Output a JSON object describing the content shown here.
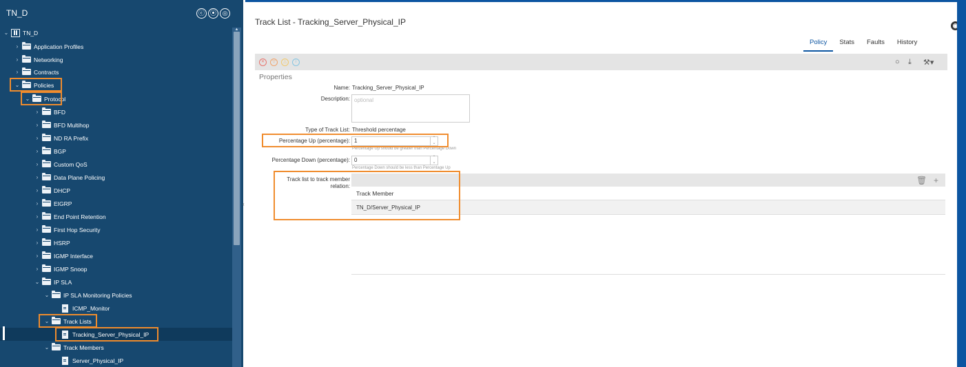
{
  "left_pane": {
    "title": "TN_D",
    "header_icons": [
      "ⓒ",
      "⦿",
      "◎"
    ],
    "tree": [
      {
        "label": "TN_D",
        "icon": "tenant-icon",
        "expanded": true
      },
      {
        "label": "Application Profiles",
        "icon": "folder-icon",
        "expanded": false
      },
      {
        "label": "Networking",
        "icon": "folder-icon",
        "expanded": false
      },
      {
        "label": "Contracts",
        "icon": "folder-icon",
        "expanded": false
      },
      {
        "label": "Policies",
        "icon": "folder-icon",
        "expanded": true
      },
      {
        "label": "Protocol",
        "icon": "folder-icon",
        "expanded": true
      },
      {
        "label": "BFD",
        "icon": "folder-icon",
        "expanded": false
      },
      {
        "label": "BFD Multihop",
        "icon": "folder-icon",
        "expanded": false
      },
      {
        "label": "ND RA Prefix",
        "icon": "folder-icon",
        "expanded": false
      },
      {
        "label": "BGP",
        "icon": "folder-icon",
        "expanded": false
      },
      {
        "label": "Custom QoS",
        "icon": "folder-icon",
        "expanded": false
      },
      {
        "label": "Data Plane Policing",
        "icon": "folder-icon",
        "expanded": false
      },
      {
        "label": "DHCP",
        "icon": "folder-icon",
        "expanded": false
      },
      {
        "label": "EIGRP",
        "icon": "folder-icon",
        "expanded": false
      },
      {
        "label": "End Point Retention",
        "icon": "folder-icon",
        "expanded": false
      },
      {
        "label": "First Hop Security",
        "icon": "folder-icon",
        "expanded": false
      },
      {
        "label": "HSRP",
        "icon": "folder-icon",
        "expanded": false
      },
      {
        "label": "IGMP Interface",
        "icon": "folder-icon",
        "expanded": false
      },
      {
        "label": "IGMP Snoop",
        "icon": "folder-icon",
        "expanded": false
      },
      {
        "label": "IP SLA",
        "icon": "folder-icon",
        "expanded": true
      },
      {
        "label": "IP SLA Monitoring Policies",
        "icon": "folder-icon",
        "expanded": true
      },
      {
        "label": "ICMP_Monitor",
        "icon": "document-icon"
      },
      {
        "label": "Track Lists",
        "icon": "folder-icon",
        "expanded": true
      },
      {
        "label": "Tracking_Server_Physical_IP",
        "icon": "document-icon",
        "selected": true
      },
      {
        "label": "Track Members",
        "icon": "folder-icon",
        "expanded": true
      },
      {
        "label": "Server_Physical_IP",
        "icon": "document-icon"
      }
    ]
  },
  "content": {
    "title": "Track List - Tracking_Server_Physical_IP",
    "tabs": [
      {
        "label": "Policy",
        "active": true
      },
      {
        "label": "Stats"
      },
      {
        "label": "Faults"
      },
      {
        "label": "History"
      }
    ],
    "fault_icons": [
      {
        "glyph": "✕",
        "color": "#e8736b"
      },
      {
        "glyph": "▽",
        "color": "#f0a36b"
      },
      {
        "glyph": "△",
        "color": "#f3c96a"
      },
      {
        "glyph": "i",
        "color": "#86c6e3"
      }
    ],
    "toolbar_actions": {
      "refresh": "○",
      "download": "⤓",
      "tools": "⚒▾"
    },
    "section_label": "Properties",
    "fields": {
      "name_label": "Name:",
      "name_value": "Tracking_Server_Physical_IP",
      "description_label": "Description:",
      "description_placeholder": "optional",
      "type_label": "Type of Track List:",
      "type_value": "Threshold percentage",
      "pct_up_label": "Percentage Up (percentage):",
      "pct_up_value": "1",
      "pct_up_hint": "Percentage Up should be greater than Percentage Down",
      "pct_down_label": "Percentage Down (percentage):",
      "pct_down_value": "0",
      "pct_down_hint": "Percentage Down should be less than Percentage Up",
      "relation_label_line1": "Track list to track member",
      "relation_label_line2": "relation:"
    },
    "relation_table": {
      "column": "Track Member",
      "rows": [
        "TN_D/Server_Physical_IP"
      ],
      "delete_icon": "🗑",
      "add_icon": "+"
    }
  }
}
